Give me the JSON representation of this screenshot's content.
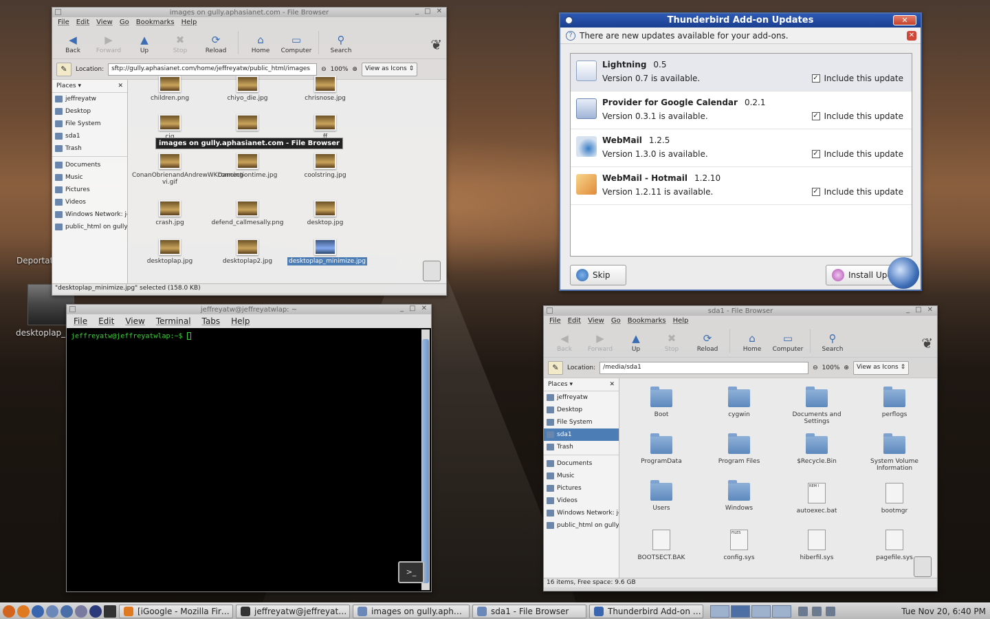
{
  "desktop": {
    "icon_labels": [
      "Deportat",
      "desktoplap_"
    ]
  },
  "fb1": {
    "title": "images on gully.aphasianet.com - File Browser",
    "menu": [
      "File",
      "Edit",
      "View",
      "Go",
      "Bookmarks",
      "Help"
    ],
    "toolbar": [
      "Back",
      "Forward",
      "Up",
      "Stop",
      "Reload",
      "Home",
      "Computer",
      "Search"
    ],
    "location_label": "Location:",
    "location": "sftp://gully.aphasianet.com/home/jeffreyatw/public_html/images",
    "zoom": "100%",
    "view": "View as Icons",
    "places_label": "Places",
    "places": [
      "jeffreyatw",
      "Desktop",
      "File System",
      "sda1",
      "Trash"
    ],
    "bookmarks": [
      "Documents",
      "Music",
      "Pictures",
      "Videos",
      "Windows Network: jeff",
      "public_html on gully.a"
    ],
    "files": [
      "children.png",
      "chiyo_die.jpg",
      "chrisnose.jpg",
      "cig",
      "",
      "ff",
      "ConanObrienandAndrewWKDancing-vi.gif",
      "connectiontime.jpg",
      "coolstring.jpg",
      "crash.jpg",
      "defend_callmesally.png",
      "desktop.jpg",
      "desktoplap.jpg",
      "desktoplap2.jpg",
      "desktoplap_minimize.jpg"
    ],
    "tooltip": "images on gully.aphasianet.com - File Browser",
    "status": "\"desktoplap_minimize.jpg\" selected (158.0 KB)"
  },
  "terminal": {
    "title": "jeffreyatw@jeffreyatwlap: ~",
    "menu": [
      "File",
      "Edit",
      "View",
      "Terminal",
      "Tabs",
      "Help"
    ],
    "prompt": "jeffreyatw@jeffreyatwlap:~$ "
  },
  "tbird": {
    "title": "Thunderbird Add-on Updates",
    "notice": "There are new updates available for your add-ons.",
    "include_label": "Include this update",
    "addons": [
      {
        "name": "Lightning",
        "current": "0.5",
        "update": "Version 0.7 is available.",
        "checked": true
      },
      {
        "name": "Provider for Google Calendar",
        "current": "0.2.1",
        "update": "Version 0.3.1 is available.",
        "checked": true
      },
      {
        "name": "WebMail",
        "current": "1.2.5",
        "update": "Version 1.3.0 is available.",
        "checked": true
      },
      {
        "name": "WebMail - Hotmail",
        "current": "1.2.10",
        "update": "Version 1.2.11 is available.",
        "checked": true
      }
    ],
    "skip": "Skip",
    "install": "Install Upd"
  },
  "fb2": {
    "title": "sda1 - File Browser",
    "menu": [
      "File",
      "Edit",
      "View",
      "Go",
      "Bookmarks",
      "Help"
    ],
    "toolbar": [
      "Back",
      "Forward",
      "Up",
      "Stop",
      "Reload",
      "Home",
      "Computer",
      "Search"
    ],
    "location_label": "Location:",
    "location": "/media/sda1",
    "zoom": "100%",
    "view": "View as Icons",
    "places_label": "Places",
    "places": [
      "jeffreyatw",
      "Desktop",
      "File System",
      "sda1",
      "Trash"
    ],
    "bookmarks": [
      "Documents",
      "Music",
      "Pictures",
      "Videos",
      "Windows Network: jeff",
      "public_html on gully.a"
    ],
    "items": [
      {
        "name": "Boot",
        "kind": "folder"
      },
      {
        "name": "cygwin",
        "kind": "folder"
      },
      {
        "name": "Documents and Settings",
        "kind": "folder"
      },
      {
        "name": "perflogs",
        "kind": "folder"
      },
      {
        "name": "ProgramData",
        "kind": "folder"
      },
      {
        "name": "Program Files",
        "kind": "folder"
      },
      {
        "name": "$Recycle.Bin",
        "kind": "folder"
      },
      {
        "name": "System Volume Information",
        "kind": "folder"
      },
      {
        "name": "Users",
        "kind": "folder"
      },
      {
        "name": "Windows",
        "kind": "folder"
      },
      {
        "name": "autoexec.bat",
        "kind": "doc",
        "mark": "REM I"
      },
      {
        "name": "bootmgr",
        "kind": "doc",
        "mark": ""
      },
      {
        "name": "BOOTSECT.BAK",
        "kind": "doc",
        "mark": ""
      },
      {
        "name": "config.sys",
        "kind": "doc",
        "mark": "FILES"
      },
      {
        "name": "hiberfil.sys",
        "kind": "doc",
        "mark": ""
      },
      {
        "name": "pagefile.sys",
        "kind": "doc",
        "mark": ""
      }
    ],
    "status": "16 items, Free space: 9.6 GB"
  },
  "taskbar": {
    "tasks": [
      "[iGoogle - Mozilla Fir…",
      "jeffreyatw@jeffreyat…",
      "images on gully.aph…",
      "sda1 - File Browser",
      "Thunderbird Add-on …"
    ],
    "clock": "Tue Nov 20,  6:40 PM"
  }
}
